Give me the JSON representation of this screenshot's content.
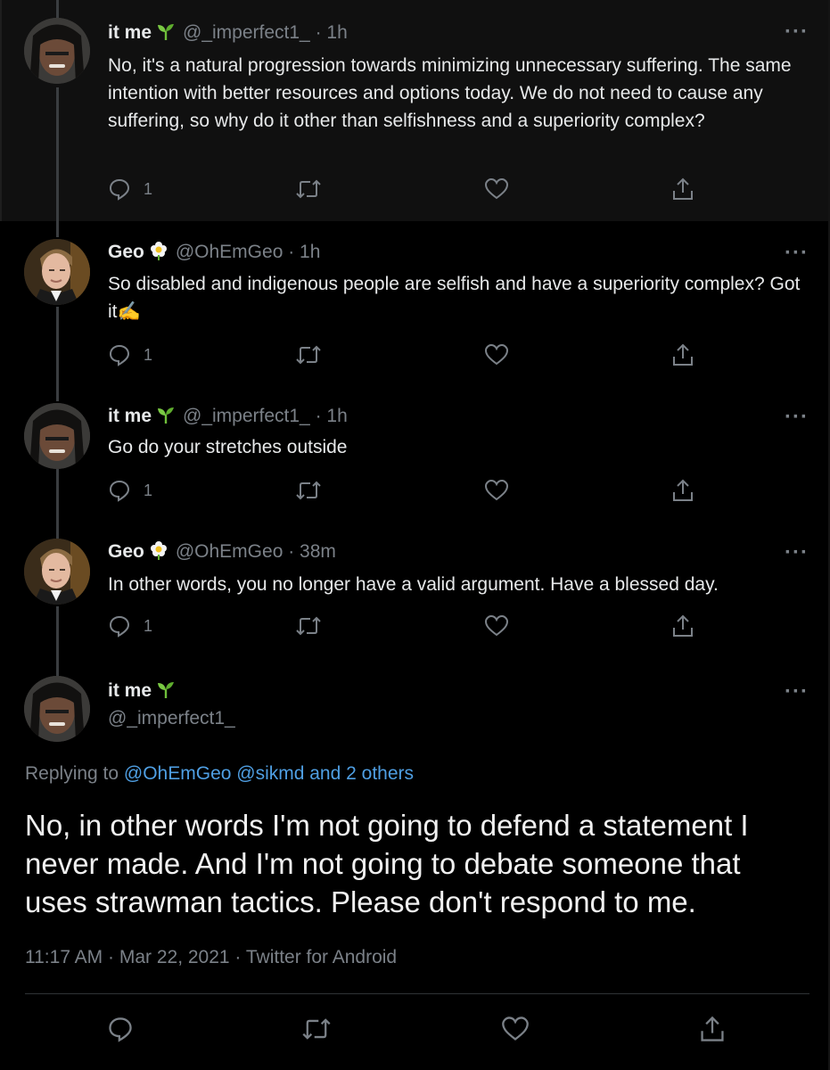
{
  "tweets": [
    {
      "name": "it me",
      "handle": "@_imperfect1_ · 1h",
      "text": "No, it's a natural progression towards minimizing unnecessary suffering. The same intention with better resources and options today. We do not need to cause any suffering, so why do it other than selfishness and a superiority complex?",
      "reply_count": "1"
    },
    {
      "name": "Geo",
      "handle": "@OhEmGeo · 1h",
      "text": "So disabled and indigenous people are selfish and have a superiority complex? Got it✍️",
      "reply_count": "1"
    },
    {
      "name": "it me",
      "handle": "@_imperfect1_ · 1h",
      "text": "Go do your stretches outside",
      "reply_count": "1"
    },
    {
      "name": "Geo",
      "handle": "@OhEmGeo · 38m",
      "text": "In other words, you no longer have a valid argument. Have a blessed day.",
      "reply_count": "1"
    }
  ],
  "focus": {
    "name": "it me",
    "handle": "@_imperfect1_",
    "replying_prefix": "Replying to",
    "replying_links": "@OhEmGeo @sikmd and 2 others",
    "text": "No, in other words I'm not going to defend a statement I never made. And I'm not going to debate someone that uses strawman tactics. Please don't respond to me.",
    "meta": "11:17 AM · Mar 22, 2021 · Twitter for Android"
  },
  "icons": {
    "more": "more-dots-icon",
    "reply": "reply-icon",
    "retweet": "retweet-icon",
    "like": "like-icon",
    "share": "share-icon",
    "sprout": "seedling-emoji",
    "blossom": "blossom-emoji"
  },
  "colors": {
    "background": "#000000",
    "first_tweet_bg": "#101010",
    "muted": "#7b8188",
    "link": "#4f9fe3",
    "text": "#e7e9ea"
  }
}
